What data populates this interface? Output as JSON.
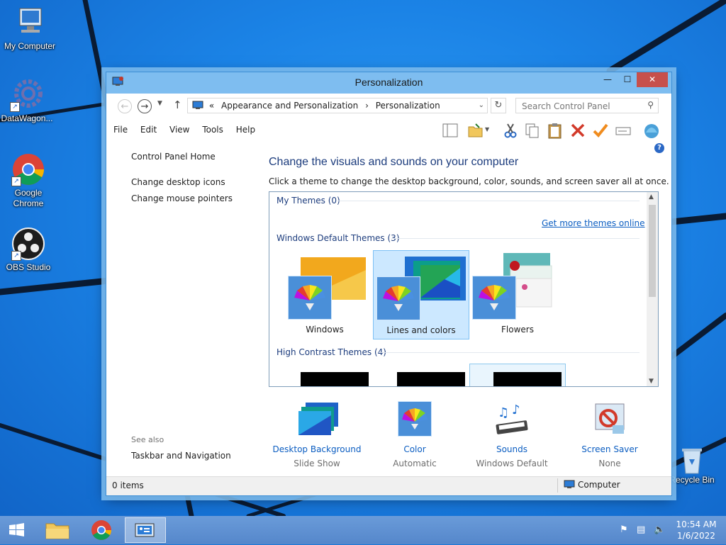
{
  "desktop": {
    "icons": [
      {
        "label": "My Computer"
      },
      {
        "label": "DataWagon..."
      },
      {
        "label": "Google Chrome"
      },
      {
        "label": "OBS Studio"
      },
      {
        "label": "Recycle Bin"
      }
    ]
  },
  "window": {
    "title": "Personalization",
    "address": {
      "overflow": "«",
      "crumb1": "Appearance and Personalization",
      "sep": "›",
      "crumb2": "Personalization"
    },
    "search_placeholder": "Search Control Panel",
    "menu": [
      "File",
      "Edit",
      "View",
      "Tools",
      "Help"
    ],
    "left": {
      "home": "Control Panel Home",
      "links": [
        "Change desktop icons",
        "Change mouse pointers"
      ],
      "see_also": "See also",
      "see_also_links": [
        "Taskbar and Navigation"
      ]
    },
    "main": {
      "heading": "Change the visuals and sounds on your computer",
      "subheading": "Click a theme to change the desktop background, color, sounds, and screen saver all at once.",
      "groups": {
        "my_themes": "My Themes (0)",
        "get_more": "Get more themes online",
        "default": "Windows Default Themes (3)",
        "high_contrast": "High Contrast Themes (4)"
      },
      "themes": [
        {
          "name": "Windows",
          "selected": false
        },
        {
          "name": "Lines and colors",
          "selected": true
        },
        {
          "name": "Flowers",
          "selected": false
        }
      ],
      "bottom": [
        {
          "label": "Desktop Background",
          "value": "Slide Show"
        },
        {
          "label": "Color",
          "value": "Automatic"
        },
        {
          "label": "Sounds",
          "value": "Windows Default"
        },
        {
          "label": "Screen Saver",
          "value": "None"
        }
      ]
    },
    "status": {
      "items": "0 items",
      "location": "Computer"
    }
  },
  "taskbar": {
    "time": "10:54 AM",
    "date": "1/6/2022"
  },
  "colors": {
    "link": "#0b5dc1",
    "heading": "#1c3c7d",
    "title_bar": "#7ebdf0",
    "close": "#c7504c",
    "selection": "#cce8ff"
  }
}
